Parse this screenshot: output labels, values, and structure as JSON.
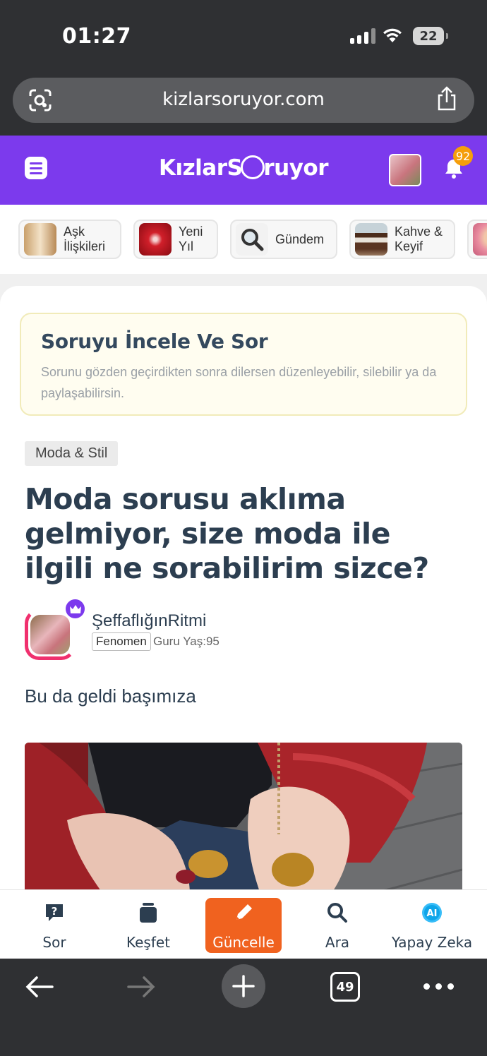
{
  "status": {
    "time": "01:27",
    "battery": "22"
  },
  "browser": {
    "url": "kizlarsoruyor.com",
    "tab_count": "49"
  },
  "header": {
    "logo_left": "Kızlar",
    "logo_s": "S",
    "logo_right": "ruyor",
    "notifications": "92"
  },
  "categories": [
    {
      "label": "Aşk\nİlişkileri"
    },
    {
      "label": "Yeni\nYıl"
    },
    {
      "label": "Gündem"
    },
    {
      "label": "Kahve &\nKeyif"
    }
  ],
  "info": {
    "title": "Soruyu İncele Ve Sor",
    "text": "Sorunu gözden geçirdikten sonra dilersen düzenleyebilir, silebilir ya da paylaşabilirsin."
  },
  "question": {
    "category": "Moda & Stil",
    "title": "Moda sorusu aklıma gelmiyor, size moda ile ilgili ne sorabilirim sizce?",
    "author": "ŞeffaflığınRitmi",
    "badge": "Fenomen",
    "level": "Guru Yaş:95",
    "body": "Bu da geldi başımıza"
  },
  "tabs": [
    {
      "label": "Sor",
      "icon": "question-icon"
    },
    {
      "label": "Keşfet",
      "icon": "cards-icon"
    },
    {
      "label": "Güncelle",
      "icon": "pencil-icon"
    },
    {
      "label": "Ara",
      "icon": "search-icon"
    },
    {
      "label": "Yapay Zeka",
      "icon": "ai-icon"
    }
  ],
  "colors": {
    "brand": "#7c3aed",
    "active_tab": "#f0621f",
    "badge": "#f59e0b"
  }
}
